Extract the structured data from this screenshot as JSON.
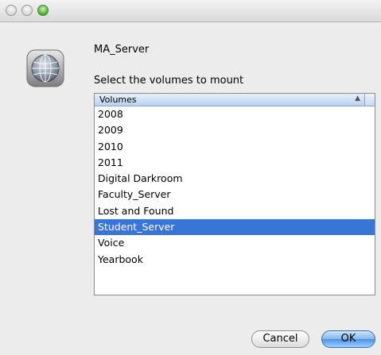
{
  "window": {
    "controls": [
      "close",
      "minimize",
      "zoom"
    ]
  },
  "dialog": {
    "icon": "network-server-globe-icon",
    "server_name": "MA_Server",
    "prompt": "Select the volumes to mount"
  },
  "volumes_list": {
    "header": "Volumes",
    "sort_indicator": "▲",
    "items": [
      "2008",
      "2009",
      "2010",
      "2011",
      "Digital Darkroom",
      "Faculty_Server",
      "Lost and Found",
      "Student_Server",
      "Voice",
      "Yearbook"
    ],
    "selected": "Student_Server"
  },
  "buttons": {
    "cancel_label": "Cancel",
    "ok_label": "OK"
  },
  "colors": {
    "selection": "#3875d7",
    "default_button": "#4a93e0",
    "zoom_button": "#4cab37"
  }
}
